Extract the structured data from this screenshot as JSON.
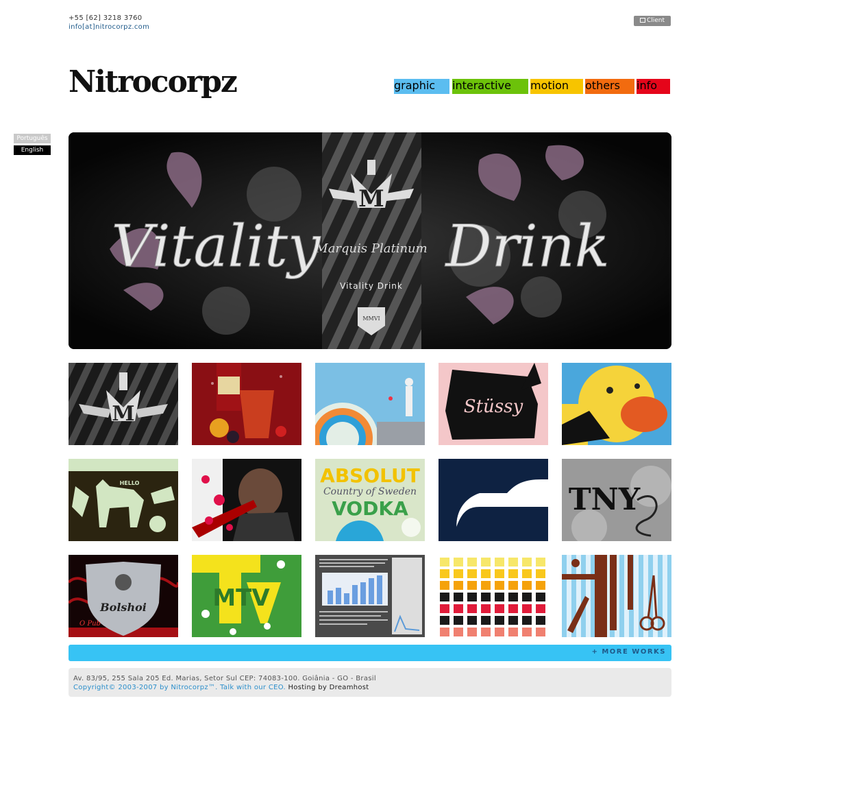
{
  "contact": {
    "phone": "+55 [62] 3218 3760",
    "email": "info[at]nitrocorpz.com"
  },
  "client_button": "Client",
  "logo": "Nitrocorpz",
  "nav": [
    {
      "label": "graphic",
      "color": "#5bbdf0"
    },
    {
      "label": "interactive",
      "color": "#6cc20a"
    },
    {
      "label": "motion",
      "color": "#f7c400"
    },
    {
      "label": "others",
      "color": "#f26b0f"
    },
    {
      "label": "info",
      "color": "#e5051a"
    }
  ],
  "languages": [
    {
      "label": "Português",
      "active": false
    },
    {
      "label": "English",
      "active": true
    }
  ],
  "hero": {
    "left_word": "Vitality",
    "right_word": "Drink",
    "brand": "Marquis Platinum",
    "sub": "Vitality Drink",
    "badge": "MMVI"
  },
  "thumbnails": [
    {
      "name": "marquis-platinum"
    },
    {
      "name": "red-label"
    },
    {
      "name": "circles-figure"
    },
    {
      "name": "stussy"
    },
    {
      "name": "yellow-duck"
    },
    {
      "name": "deer-hello",
      "text": "HELLO"
    },
    {
      "name": "bb-king"
    },
    {
      "name": "absolut-vodka",
      "text1": "ABSOLUT",
      "text2": "Country of Sweden",
      "text3": "VODKA"
    },
    {
      "name": "navy-logo"
    },
    {
      "name": "tny",
      "text": "TNY"
    },
    {
      "name": "bolshoi-pub",
      "text1": "Bolshoi",
      "text2": "O Pub"
    },
    {
      "name": "mtv",
      "text": "MTV"
    },
    {
      "name": "bar-chart-doc"
    },
    {
      "name": "color-grid"
    },
    {
      "name": "tools-pattern"
    }
  ],
  "more_works": "+ MORE WORKS",
  "footer": {
    "address": "Av. 83/95, 255 Sala 205 Ed. Marias, Setor Sul CEP: 74083-100. Goiânia - GO - Brasil",
    "copyright": "Copyright© 2003-2007 by Nitrocorpz™.",
    "ceo": "Talk with our CEO.",
    "hosting": "Hosting by Dreamhost"
  }
}
